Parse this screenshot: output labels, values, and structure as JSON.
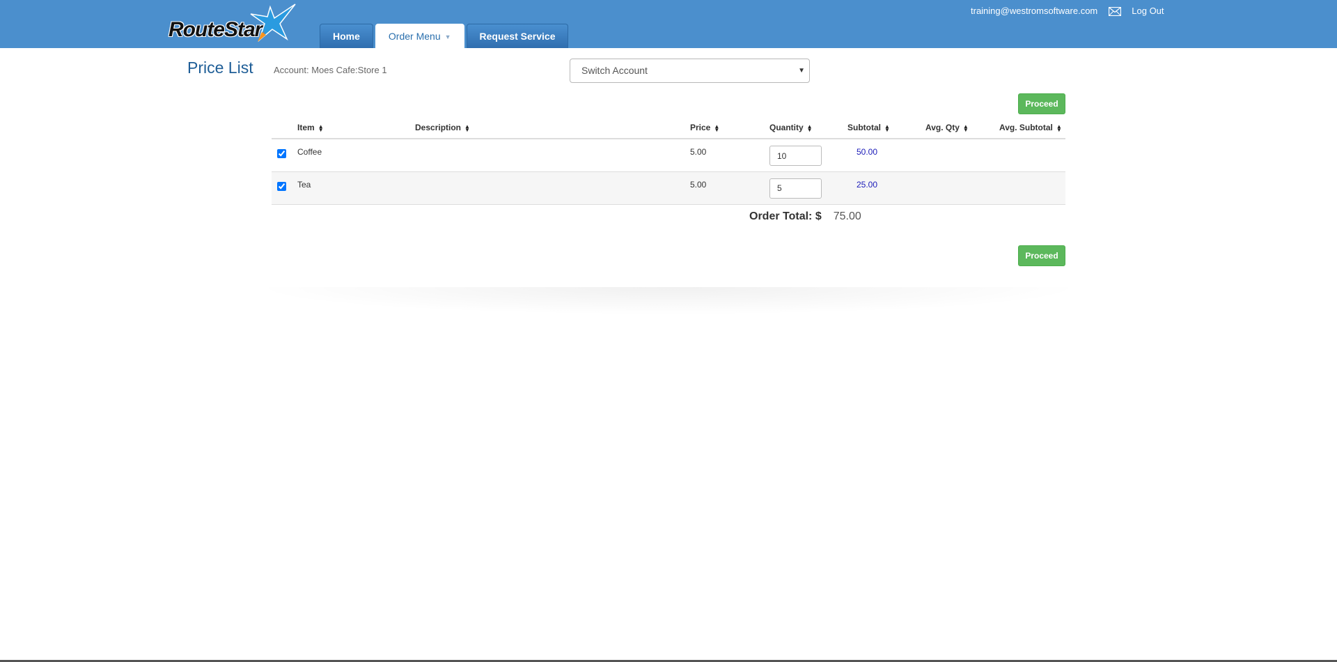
{
  "app": {
    "logo_text": "RouteStar"
  },
  "nav": {
    "tabs": [
      {
        "label": "Home"
      },
      {
        "label": "Order Menu"
      },
      {
        "label": "Request Service"
      }
    ]
  },
  "user": {
    "email": "training@westromsoftware.com",
    "logout_label": "Log Out",
    "mail_icon": "envelope-icon"
  },
  "page": {
    "title": "Price List",
    "account_label": "Account: Moes Cafe:Store 1",
    "switch_account_placeholder": "Switch Account",
    "proceed_label": "Proceed"
  },
  "table": {
    "headers": {
      "item": "Item",
      "description": "Description",
      "price": "Price",
      "quantity": "Quantity",
      "subtotal": "Subtotal",
      "avg_qty": "Avg. Qty",
      "avg_subtotal": "Avg. Subtotal"
    },
    "rows": [
      {
        "checked": true,
        "item": "Coffee",
        "description": "",
        "price": "5.00",
        "quantity": "10",
        "subtotal": "50.00",
        "avg_qty": "",
        "avg_subtotal": ""
      },
      {
        "checked": true,
        "item": "Tea",
        "description": "",
        "price": "5.00",
        "quantity": "5",
        "subtotal": "25.00",
        "avg_qty": "",
        "avg_subtotal": ""
      }
    ]
  },
  "order_total": {
    "label": "Order Total: $",
    "value": "75.00"
  },
  "colors": {
    "header_bg": "#4b8fcd",
    "title_blue": "#1f5e97",
    "proceed_green": "#5cb85c",
    "subtotal_blue": "#1a1ab8"
  }
}
